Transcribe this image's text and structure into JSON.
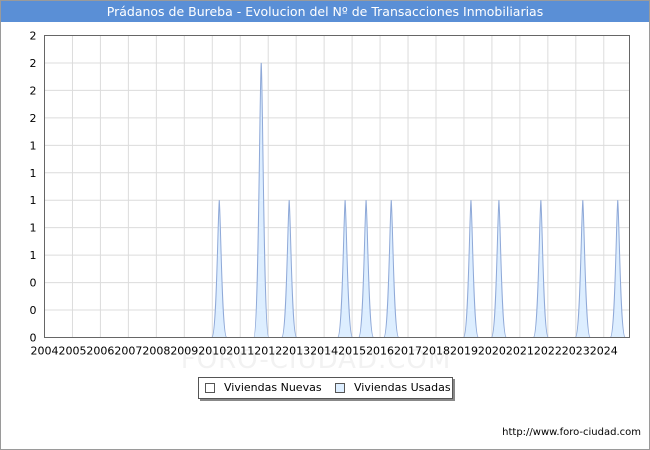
{
  "chart_data": {
    "type": "area",
    "title": "Prádanos de Bureba - Evolucion del Nº de Transacciones Inmobiliarias",
    "x_ticks": [
      "2004",
      "2005",
      "2006",
      "2007",
      "2008",
      "2009",
      "2010",
      "2011",
      "2012",
      "2013",
      "2014",
      "2015",
      "2016",
      "2017",
      "2018",
      "2019",
      "2020",
      "2021",
      "2022",
      "2023",
      "2024"
    ],
    "y_ticks": [
      "0",
      "0",
      "0",
      "1",
      "1",
      "1",
      "1",
      "1",
      "2",
      "2",
      "2",
      "2"
    ],
    "ylim": [
      0,
      2.2
    ],
    "xlim": [
      2004,
      2024.92
    ],
    "grid": true,
    "series": [
      {
        "name": "Viviendas Nuevas",
        "color": "#ffffff",
        "points": []
      },
      {
        "name": "Viviendas Usadas",
        "color": "#ddeeff",
        "line_color": "#8fa9d8",
        "points": [
          {
            "x": 2010.25,
            "y": 1
          },
          {
            "x": 2011.75,
            "y": 2
          },
          {
            "x": 2012.75,
            "y": 1
          },
          {
            "x": 2014.75,
            "y": 1
          },
          {
            "x": 2015.5,
            "y": 1
          },
          {
            "x": 2016.4,
            "y": 1
          },
          {
            "x": 2019.25,
            "y": 1
          },
          {
            "x": 2020.25,
            "y": 1
          },
          {
            "x": 2021.75,
            "y": 1
          },
          {
            "x": 2023.25,
            "y": 1
          },
          {
            "x": 2024.5,
            "y": 1
          }
        ]
      }
    ],
    "legend_position": "bottom-center"
  },
  "legend": {
    "nuevas_label": "Viviendas Nuevas",
    "usadas_label": "Viviendas Usadas",
    "nuevas_color": "#ffffff",
    "usadas_color": "#ddeeff"
  },
  "footer": {
    "url": "http://www.foro-ciudad.com"
  },
  "watermark": "FORO-CIUDAD.COM"
}
